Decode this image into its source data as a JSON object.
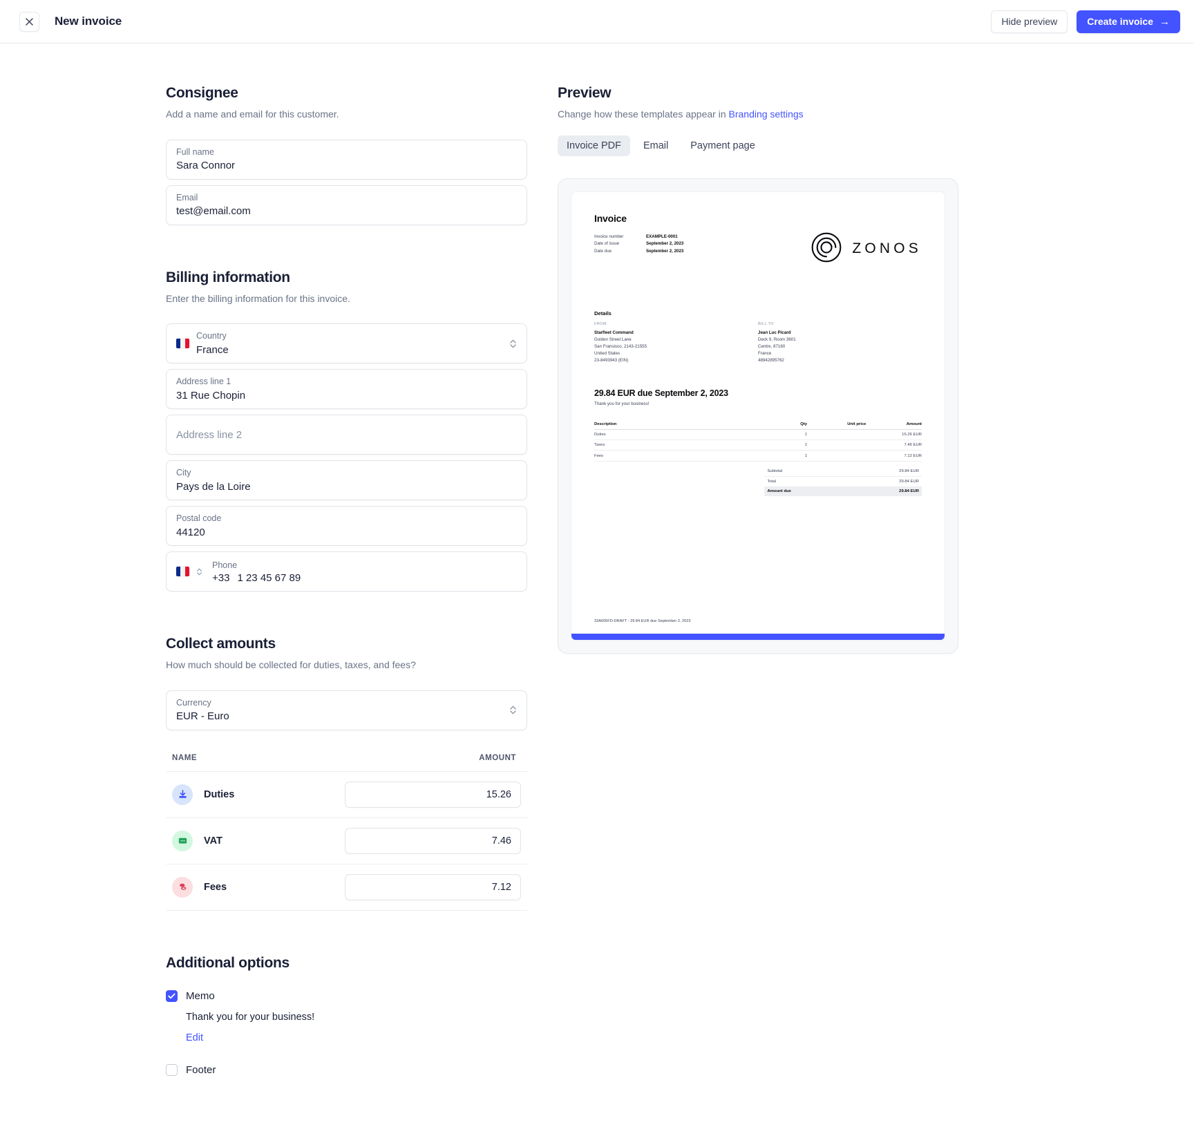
{
  "topbar": {
    "title": "New invoice",
    "close_icon": "close-icon",
    "hide_preview_label": "Hide preview",
    "create_invoice_label": "Create invoice",
    "create_invoice_arrow": "→",
    "primary_color": "#4353ff"
  },
  "consignee": {
    "title": "Consignee",
    "subtitle": "Add a name and email for this customer.",
    "full_name_label": "Full name",
    "full_name_value": "Sara Connor",
    "email_label": "Email",
    "email_value": "test@email.com"
  },
  "billing": {
    "title": "Billing information",
    "subtitle": "Enter the billing information for this invoice.",
    "country_label": "Country",
    "country_value": "France",
    "country_flag": "france-flag-icon",
    "address1_label": "Address line 1",
    "address1_value": "31 Rue Chopin",
    "address2_placeholder": "Address line 2",
    "address2_value": "",
    "city_label": "City",
    "city_value": "Pays de la Loire",
    "postal_label": "Postal code",
    "postal_value": "44120",
    "phone_label": "Phone",
    "phone_code": "+33",
    "phone_value": "1 23 45 67 89"
  },
  "collect": {
    "title": "Collect amounts",
    "subtitle": "How much should be collected for duties, taxes, and fees?",
    "currency_label": "Currency",
    "currency_value": "EUR - Euro",
    "col_name": "NAME",
    "col_amount": "AMOUNT",
    "rows": [
      {
        "name": "Duties",
        "amount": "15.26",
        "icon": "download-arrow-icon",
        "badge_color": "#d7e4fb"
      },
      {
        "name": "VAT",
        "amount": "7.46",
        "icon": "receipt-card-icon",
        "badge_color": "#d3f7e0"
      },
      {
        "name": "Fees",
        "amount": "7.12",
        "icon": "coins-icon",
        "badge_color": "#fcdde0"
      }
    ]
  },
  "additional": {
    "title": "Additional options",
    "memo_label": "Memo",
    "memo_checked": true,
    "memo_text": "Thank you for your business!",
    "memo_edit_label": "Edit",
    "footer_label": "Footer",
    "footer_checked": false
  },
  "preview": {
    "title": "Preview",
    "subtitle_prefix": "Change how these templates appear in ",
    "subtitle_link": "Branding settings",
    "tabs": [
      {
        "label": "Invoice PDF",
        "active": true
      },
      {
        "label": "Email",
        "active": false
      },
      {
        "label": "Payment page",
        "active": false
      }
    ]
  },
  "invoice_doc": {
    "heading": "Invoice",
    "meta": [
      {
        "key": "Invoice number",
        "value": "EXAMPLE-0001"
      },
      {
        "key": "Date of issue",
        "value": "September 2, 2023"
      },
      {
        "key": "Date due",
        "value": "September 2, 2023"
      }
    ],
    "brand_name": "ZONOS",
    "brand_logo": "zonos-spiral-logo-icon",
    "details_title": "Details",
    "from_heading": "FROM",
    "from_lines": [
      "Starfleet Command",
      "Golden Street Lane",
      "San Fransisco, 2143-21555",
      "United States",
      "23-8493943 (EIN)"
    ],
    "billto_heading": "BILL TO",
    "billto_lines": [
      "Jean Luc Picard",
      "Deck 9, Room 3601",
      "Centre, 87160",
      "France",
      "48942895762"
    ],
    "due_line": "29.84 EUR due September 2, 2023",
    "thanks_line": "Thank you for your business!",
    "table_headers": [
      "Description",
      "Qty",
      "Unit price",
      "Amount"
    ],
    "table_rows": [
      {
        "description": "Duties",
        "qty": "1",
        "unit_price": "",
        "amount": "15.26 EUR"
      },
      {
        "description": "Taxes",
        "qty": "1",
        "unit_price": "",
        "amount": "7.46 EUR"
      },
      {
        "description": "Fees",
        "qty": "1",
        "unit_price": "",
        "amount": "7.12 EUR"
      }
    ],
    "summary": [
      {
        "label": "Subtotal",
        "value": "29.84 EUR"
      },
      {
        "label": "Total",
        "value": "29.84 EUR"
      },
      {
        "label": "Amount due",
        "value": "29.84 EUR"
      }
    ],
    "footer_text": "33A605FD-DRAFT - 29.84 EUR due September 2, 2023",
    "accent_color": "#4353ff"
  }
}
